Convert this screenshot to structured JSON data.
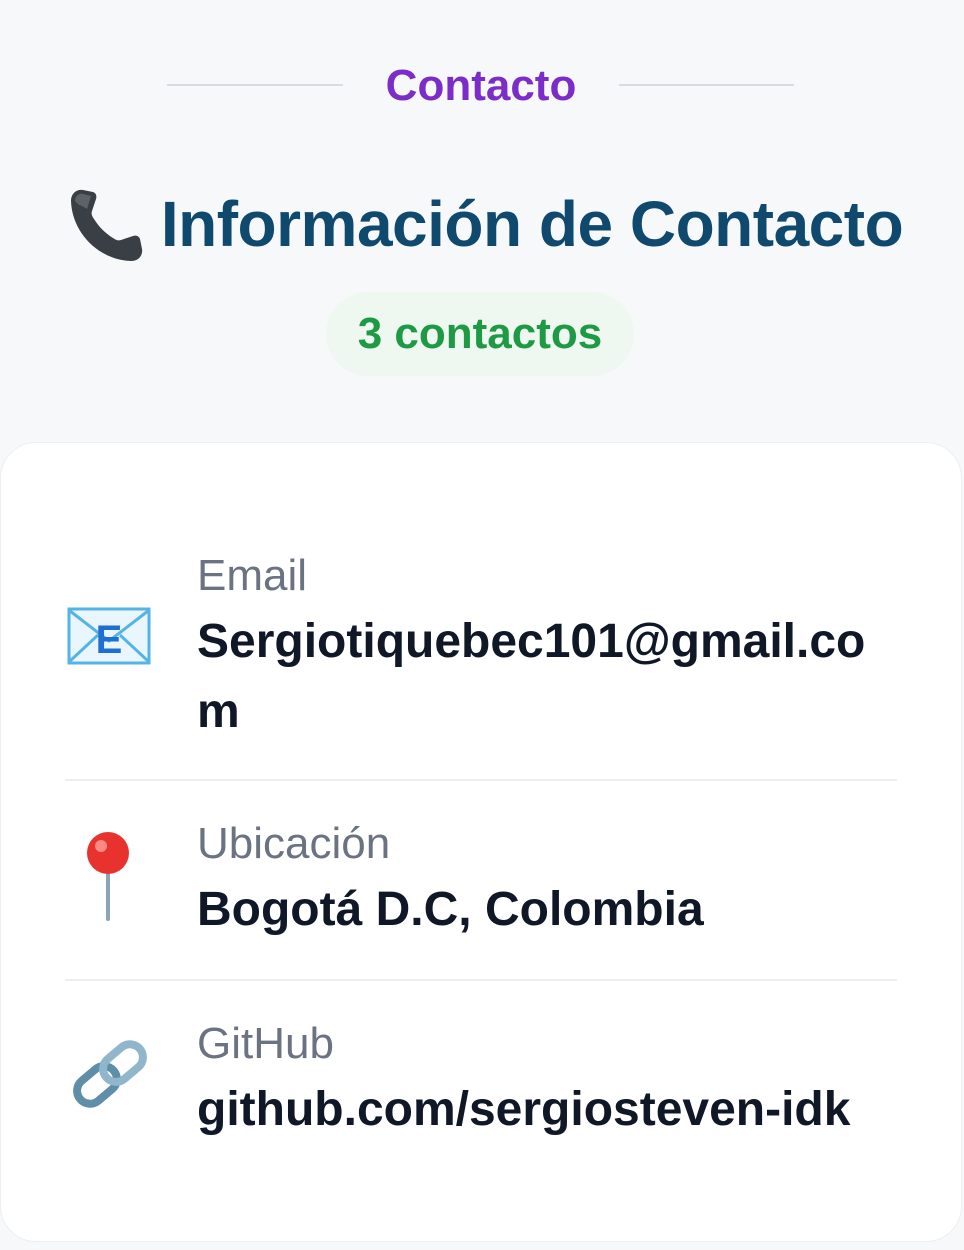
{
  "section": {
    "label": "Contacto"
  },
  "header": {
    "title_icon": "telephone-receiver-icon",
    "title": "Información de Contacto",
    "count_badge": "3 contactos"
  },
  "contacts": [
    {
      "icon": "envelope-icon",
      "label": "Email",
      "value": "Sergiotiquebec101@gmail.com"
    },
    {
      "icon": "pushpin-icon",
      "label": "Ubicación",
      "value": "Bogotá D.C, Colombia"
    },
    {
      "icon": "link-icon",
      "label": "GitHub",
      "value": "github.com/sergiosteven-idk"
    }
  ],
  "colors": {
    "accent_purple": "#7b2cc9",
    "title_blue": "#0f4a6e",
    "badge_green": "#1f9a44",
    "badge_bg": "#eef8f0",
    "label_gray": "#6b7282",
    "value_dark": "#101828"
  }
}
